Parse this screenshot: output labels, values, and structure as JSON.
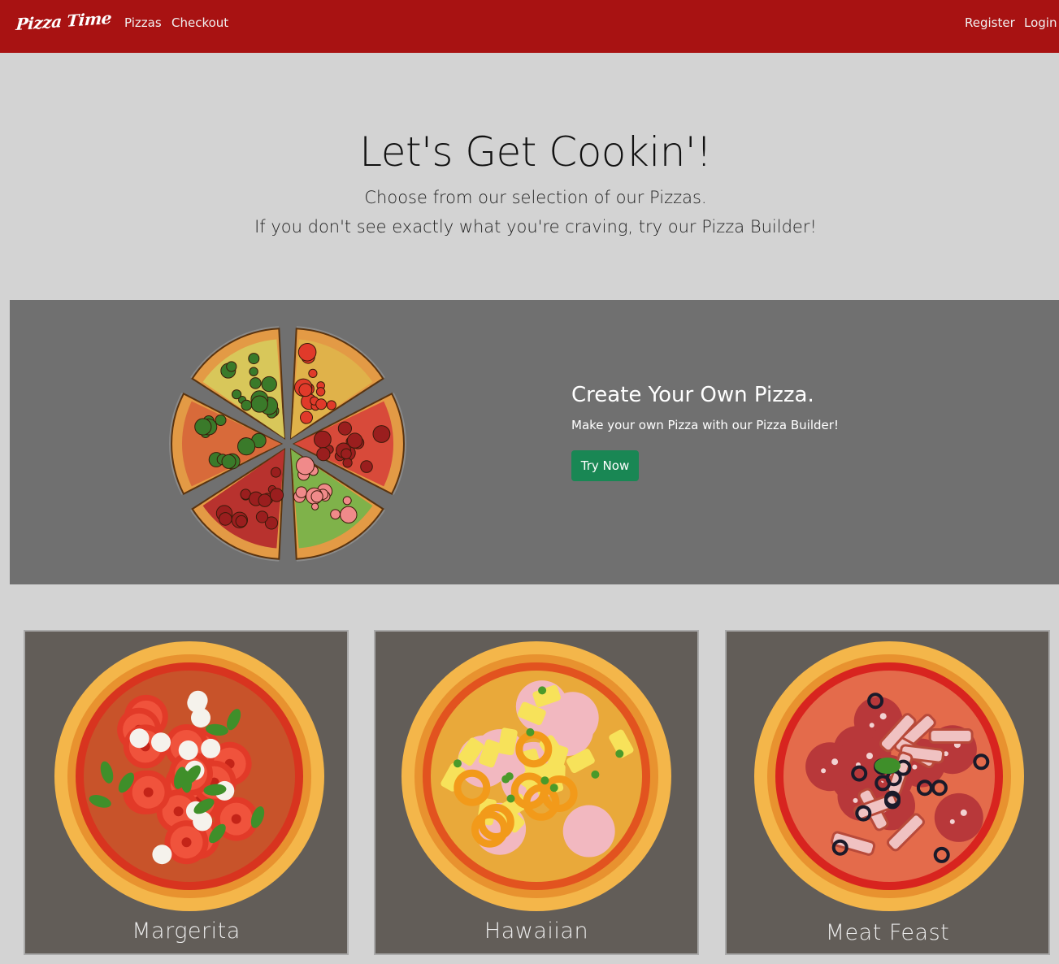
{
  "navbar": {
    "brand": "Pizza Time",
    "links_left": [
      "Pizzas",
      "Checkout"
    ],
    "links_right": [
      "Register",
      "Login"
    ],
    "background": "#a81212"
  },
  "hero": {
    "title": "Let's Get Cookin'!",
    "line1": "Choose from our selection of our Pizzas.",
    "line2": "If you don't see exactly what you're craving, try our Pizza Builder!"
  },
  "builder": {
    "image_icon": "sliced-pizza-illustration",
    "title": "Create Your Own Pizza.",
    "subtitle": "Make your own Pizza with our Pizza Builder!",
    "button_label": "Try Now",
    "button_color": "#198754"
  },
  "pizzas": [
    {
      "name": "Margerita",
      "image_icon": "margherita-pizza-illustration"
    },
    {
      "name": "Hawaiian",
      "image_icon": "hawaiian-pizza-illustration"
    },
    {
      "name": "Meat Feast",
      "image_icon": "meat-feast-pizza-illustration"
    }
  ]
}
